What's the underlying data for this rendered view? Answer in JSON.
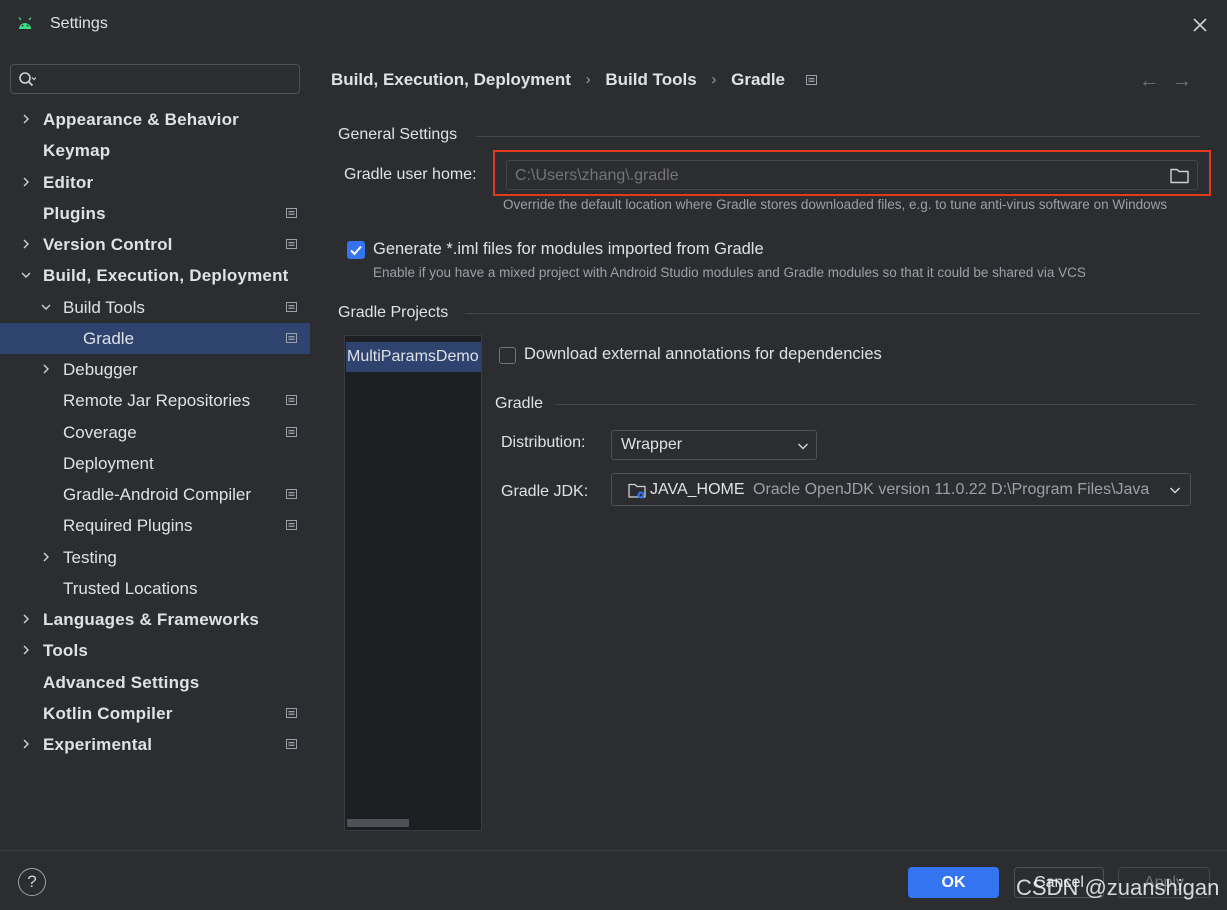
{
  "window": {
    "title": "Settings",
    "app_icon": "android-icon",
    "close_icon": "close-icon"
  },
  "colors": {
    "background": "#2b2d30",
    "accent": "#3574f0",
    "selection": "#2e436e",
    "highlight": "#e0391b"
  },
  "sidebar": {
    "search": {
      "icon": "search-icon",
      "value": ""
    },
    "items": [
      {
        "label": "Appearance & Behavior",
        "bold": true,
        "chevron": "right",
        "page_icon": false
      },
      {
        "label": "Keymap",
        "bold": true,
        "chevron": "none",
        "page_icon": false
      },
      {
        "label": "Editor",
        "bold": true,
        "chevron": "right",
        "page_icon": false
      },
      {
        "label": "Plugins",
        "bold": true,
        "chevron": "none",
        "page_icon": true
      },
      {
        "label": "Version Control",
        "bold": true,
        "chevron": "right",
        "page_icon": true
      },
      {
        "label": "Build, Execution, Deployment",
        "bold": true,
        "chevron": "down",
        "page_icon": false
      },
      {
        "label": "Build Tools",
        "bold": false,
        "chevron": "down",
        "page_icon": true
      },
      {
        "label": "Gradle",
        "bold": false,
        "chevron": "none",
        "page_icon": true,
        "selected": true
      },
      {
        "label": "Debugger",
        "bold": false,
        "chevron": "right",
        "page_icon": false
      },
      {
        "label": "Remote Jar Repositories",
        "bold": false,
        "chevron": "none",
        "page_icon": true
      },
      {
        "label": "Coverage",
        "bold": false,
        "chevron": "none",
        "page_icon": true
      },
      {
        "label": "Deployment",
        "bold": false,
        "chevron": "none",
        "page_icon": false
      },
      {
        "label": "Gradle-Android Compiler",
        "bold": false,
        "chevron": "none",
        "page_icon": true
      },
      {
        "label": "Required Plugins",
        "bold": false,
        "chevron": "none",
        "page_icon": true
      },
      {
        "label": "Testing",
        "bold": false,
        "chevron": "right",
        "page_icon": false
      },
      {
        "label": "Trusted Locations",
        "bold": false,
        "chevron": "none",
        "page_icon": false
      },
      {
        "label": "Languages & Frameworks",
        "bold": true,
        "chevron": "right",
        "page_icon": false
      },
      {
        "label": "Tools",
        "bold": true,
        "chevron": "right",
        "page_icon": false
      },
      {
        "label": "Advanced Settings",
        "bold": true,
        "chevron": "none",
        "page_icon": false
      },
      {
        "label": "Kotlin Compiler",
        "bold": true,
        "chevron": "none",
        "page_icon": true
      },
      {
        "label": "Experimental",
        "bold": true,
        "chevron": "right",
        "page_icon": true
      }
    ]
  },
  "main": {
    "breadcrumb": [
      "Build, Execution, Deployment",
      "Build Tools",
      "Gradle"
    ],
    "breadcrumb_separator": "›",
    "nav": {
      "back": "←",
      "forward": "→"
    },
    "general_settings": {
      "title": "General Settings",
      "user_home_label": "Gradle user home:",
      "user_home_placeholder": "C:\\Users\\zhang\\.gradle",
      "user_home_hint": "Override the default location where Gradle stores downloaded files, e.g. to tune anti-virus software on Windows",
      "iml_checked": true,
      "iml_label": "Generate *.iml files for modules imported from Gradle",
      "iml_hint": "Enable if you have a mixed project with Android Studio modules and Gradle modules so that it could be shared via VCS"
    },
    "gradle_projects": {
      "title": "Gradle Projects",
      "projects": [
        "MultiParamsDemo"
      ],
      "download_annotations_checked": false,
      "download_annotations_label": "Download external annotations for dependencies",
      "gradle_section_title": "Gradle",
      "distribution_label": "Distribution:",
      "distribution_value": "Wrapper",
      "jdk_label": "Gradle JDK:",
      "jdk_name": "JAVA_HOME",
      "jdk_detail": "Oracle OpenJDK version 11.0.22 D:\\Program Files\\Java"
    }
  },
  "footer": {
    "help_label": "?",
    "ok_label": "OK",
    "cancel_label": "Cancel",
    "apply_label": "Apply",
    "watermark": "CSDN @zuanshigan"
  }
}
